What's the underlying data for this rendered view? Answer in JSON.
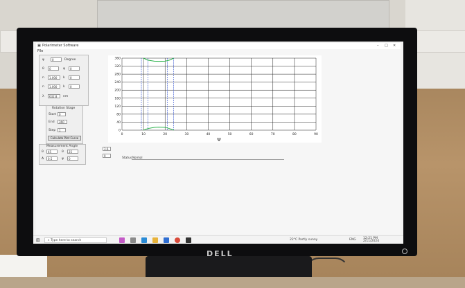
{
  "app": {
    "title": "Polarimeter Software",
    "menu_file": "File",
    "window_controls": {
      "minimize": "–",
      "maximize": "□",
      "close": "✕"
    }
  },
  "left_panel": {
    "top_group": {
      "rows": [
        {
          "label": "ψ",
          "value": "0",
          "unit": "Degree"
        },
        {
          "label": "θ",
          "value": "0",
          "label2": "φ",
          "value2": "0"
        },
        {
          "label": "n",
          "value": "1.000",
          "label2": "k",
          "value2": "0"
        },
        {
          "label": "n",
          "value": "1.000",
          "label2": "k",
          "value2": "0"
        },
        {
          "label": "λ",
          "value": "632.8",
          "unit": "nm"
        }
      ]
    },
    "rotation_group": {
      "title": "Rotation Stage",
      "start_label": "Start",
      "start_value": "0",
      "end_label": "End",
      "end_value": "360",
      "step_label": "Step",
      "step_value": "1",
      "button": "Calculate Plot Curve"
    },
    "measurement_group": {
      "title": "Measurement Angle",
      "rows": [
        {
          "label": "θ",
          "value": "45",
          "label2": "θ",
          "value2": "25"
        },
        {
          "label": "Δ",
          "value": "0.5",
          "label2": "ψ",
          "value2": "0"
        }
      ]
    }
  },
  "right_fields": {
    "f1": "3.6",
    "f2": "0",
    "status_label": "Status",
    "status_value": "Normal"
  },
  "chart_data": {
    "type": "line",
    "xlabel": "Ψ",
    "ylabel": "",
    "xlim": [
      0,
      90
    ],
    "ylim": [
      0,
      360
    ],
    "x_ticks": [
      "0",
      "10",
      "20",
      "30",
      "40",
      "50",
      "60",
      "70",
      "80",
      "90"
    ],
    "y_ticks": [
      "0",
      "40",
      "80",
      "120",
      "160",
      "200",
      "240",
      "280",
      "320",
      "360"
    ],
    "grid": true,
    "vlines": [
      9,
      12,
      21,
      24
    ],
    "series": [
      {
        "x": [
          10,
          12,
          15,
          17,
          20,
          22,
          24
        ],
        "y": [
          360,
          350,
          345,
          344,
          345,
          350,
          360
        ]
      },
      {
        "x": [
          10,
          12,
          15,
          17,
          20,
          22,
          24
        ],
        "y": [
          0,
          8,
          14,
          15,
          14,
          8,
          0
        ]
      }
    ],
    "colors": {
      "curve": "#2ab24a",
      "vline": "#3050d0",
      "grid": "#222222"
    }
  },
  "taskbar": {
    "search_placeholder": "Type here to search",
    "weather": "22°C  Partly sunny",
    "time": "12:21 PM",
    "date": "2/11/2024",
    "lang": "ENG",
    "icons": [
      "task-view-icon",
      "edge-icon",
      "file-explorer-icon",
      "store-icon",
      "mail-icon",
      "chrome-icon",
      "polarimeter-icon"
    ]
  },
  "brand": "DELL"
}
